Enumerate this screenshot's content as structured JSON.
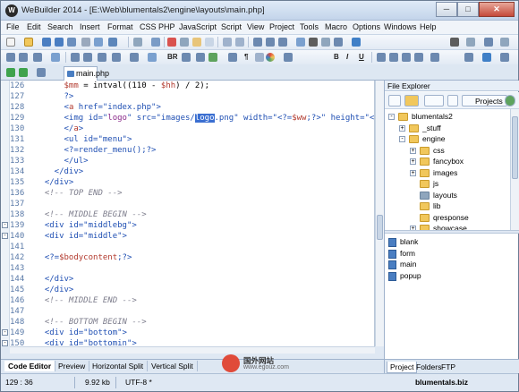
{
  "window": {
    "title": "WeBuilder 2014 - [E:\\Web\\blumentals2\\engine\\layouts\\main.php]",
    "app_icon_letter": "W"
  },
  "menu": [
    "File",
    "Edit",
    "Search",
    "Insert",
    "Format",
    "CSS",
    "PHP",
    "JavaScript",
    "Script",
    "View",
    "Project",
    "Tools",
    "Macro",
    "Options",
    "Windows",
    "Help"
  ],
  "toolbar": {
    "bold_label": "B",
    "italic_label": "I",
    "underline_label": "U",
    "br_label": "BR",
    "pilcrow_label": "¶"
  },
  "tabs": [
    {
      "label": "main.php"
    }
  ],
  "editor": {
    "lines": [
      {
        "num": "126",
        "fold": "",
        "tokens": [
          [
            "      ",
            ""
          ],
          [
            "$mm",
            "var"
          ],
          [
            " = intval((110 - ",
            ""
          ],
          [
            "$hh",
            "var"
          ],
          [
            ") / 2);",
            ""
          ]
        ]
      },
      {
        "num": "127",
        "fold": "",
        "tokens": [
          [
            "      ?>",
            "tag"
          ]
        ]
      },
      {
        "num": "128",
        "fold": "",
        "tokens": [
          [
            "      <",
            "tag"
          ],
          [
            "a",
            "el"
          ],
          [
            " href=\"index.php\">",
            "tag"
          ]
        ]
      },
      {
        "num": "129",
        "fold": "",
        "tokens": [
          [
            "      <img id=\"",
            "tag"
          ],
          [
            "logo",
            "str"
          ],
          [
            "\" src=\"images/",
            "tag"
          ],
          [
            "logo",
            "hl"
          ],
          [
            ".png\" width=\"<?=",
            "tag"
          ],
          [
            "$ww",
            "var"
          ],
          [
            ";?>\" height=\"<?=",
            "tag"
          ],
          [
            "$hh",
            "var"
          ],
          [
            ";?>",
            "tag"
          ]
        ]
      },
      {
        "num": "130",
        "fold": "",
        "tokens": [
          [
            "      </",
            "tag"
          ],
          [
            "a",
            "el"
          ],
          [
            ">",
            "tag"
          ]
        ]
      },
      {
        "num": "131",
        "fold": "",
        "tokens": [
          [
            "      <ul id=\"menu\">",
            "tag"
          ]
        ]
      },
      {
        "num": "132",
        "fold": "",
        "tokens": [
          [
            "      <?=render_menu();?>",
            "tag"
          ]
        ]
      },
      {
        "num": "133",
        "fold": "",
        "tokens": [
          [
            "      </ul>",
            "tag"
          ]
        ]
      },
      {
        "num": "134",
        "fold": "",
        "tokens": [
          [
            "    </div>",
            "tag"
          ]
        ]
      },
      {
        "num": "135",
        "fold": "",
        "tokens": [
          [
            "  </div>",
            "tag"
          ]
        ]
      },
      {
        "num": "136",
        "fold": "",
        "tokens": [
          [
            "  <!-- TOP END -->",
            "cmt"
          ]
        ]
      },
      {
        "num": "137",
        "fold": "",
        "tokens": [
          [
            "",
            ""
          ]
        ]
      },
      {
        "num": "138",
        "fold": "",
        "tokens": [
          [
            "  <!-- MIDDLE BEGIN -->",
            "cmt"
          ]
        ]
      },
      {
        "num": "139",
        "fold": "-",
        "tokens": [
          [
            "  <div id=\"middlebg\">",
            "tag"
          ]
        ]
      },
      {
        "num": "140",
        "fold": "-",
        "tokens": [
          [
            "  <div id=\"middle\">",
            "tag"
          ]
        ]
      },
      {
        "num": "141",
        "fold": "",
        "tokens": [
          [
            "",
            ""
          ]
        ]
      },
      {
        "num": "142",
        "fold": "",
        "tokens": [
          [
            "  <?=",
            "tag"
          ],
          [
            "$bodycontent",
            "var"
          ],
          [
            ";?>",
            "tag"
          ]
        ]
      },
      {
        "num": "143",
        "fold": "",
        "tokens": [
          [
            "",
            ""
          ]
        ]
      },
      {
        "num": "144",
        "fold": "",
        "tokens": [
          [
            "  </div>",
            "tag"
          ]
        ]
      },
      {
        "num": "145",
        "fold": "",
        "tokens": [
          [
            "  </div>",
            "tag"
          ]
        ]
      },
      {
        "num": "146",
        "fold": "",
        "tokens": [
          [
            "  <!-- MIDDLE END -->",
            "cmt"
          ]
        ]
      },
      {
        "num": "147",
        "fold": "",
        "tokens": [
          [
            "",
            ""
          ]
        ]
      },
      {
        "num": "148",
        "fold": "",
        "tokens": [
          [
            "  <!-- BOTTOM BEGIN -->",
            "cmt"
          ]
        ]
      },
      {
        "num": "149",
        "fold": "-",
        "tokens": [
          [
            "  <div id=\"bottom\">",
            "tag"
          ]
        ]
      },
      {
        "num": "150",
        "fold": "-",
        "tokens": [
          [
            "  <div id=\"bottomin\">",
            "tag"
          ]
        ]
      }
    ]
  },
  "bottom_tabs": [
    "Code Editor",
    "Preview",
    "Horizontal Split",
    "Vertical Split"
  ],
  "status": {
    "position": "129 : 36",
    "size": "9.92 kb",
    "encoding": "UTF-8 *",
    "project": "blumentals.biz"
  },
  "watermark": {
    "title": "国外网站",
    "url": "www.egouz.com"
  },
  "file_explorer": {
    "title": "File Explorer",
    "projects_button": "Projects",
    "tree": [
      {
        "label": "blumentals2",
        "indent": 0,
        "expander": "-",
        "color": "yellow"
      },
      {
        "label": "_stuff",
        "indent": 1,
        "expander": "+",
        "color": "yellow"
      },
      {
        "label": "engine",
        "indent": 1,
        "expander": "-",
        "color": "yellow"
      },
      {
        "label": "css",
        "indent": 2,
        "expander": "+",
        "color": "yellow"
      },
      {
        "label": "fancybox",
        "indent": 2,
        "expander": "+",
        "color": "yellow"
      },
      {
        "label": "images",
        "indent": 2,
        "expander": "+",
        "color": "yellow"
      },
      {
        "label": "js",
        "indent": 2,
        "expander": "",
        "color": "yellow"
      },
      {
        "label": "layouts",
        "indent": 2,
        "expander": "",
        "color": "blue"
      },
      {
        "label": "lib",
        "indent": 2,
        "expander": "",
        "color": "yellow"
      },
      {
        "label": "qresponse",
        "indent": 2,
        "expander": "",
        "color": "yellow"
      },
      {
        "label": "showcase",
        "indent": 2,
        "expander": "+",
        "color": "yellow"
      }
    ],
    "files": [
      "blank",
      "form",
      "main",
      "popup"
    ],
    "tabs": [
      "Project",
      "Folders",
      "FTP"
    ]
  },
  "colors": {
    "accent": "#3b6fd1",
    "keyword": "#1f4fb3",
    "variable": "#b23a2e",
    "comment": "#7d7d8c",
    "string": "#8b2b8b"
  }
}
